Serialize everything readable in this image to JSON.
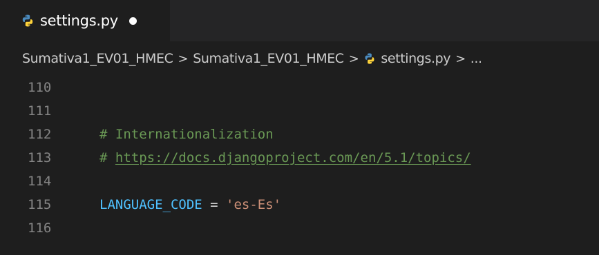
{
  "tab": {
    "label": "settings.py",
    "icon": "python-icon",
    "modified": true
  },
  "breadcrumb": {
    "items": [
      "Sumativa1_EV01_HMEC",
      "Sumativa1_EV01_HMEC",
      "settings.py",
      "..."
    ],
    "separator": ">"
  },
  "editor": {
    "lines": [
      {
        "number": "110",
        "text": ""
      },
      {
        "number": "111",
        "text": ""
      },
      {
        "number": "112",
        "hash": "# ",
        "text": "Internationalization"
      },
      {
        "number": "113",
        "hash": "# ",
        "text": "https://docs.djangoproject.com/en/5.1/topics/"
      },
      {
        "number": "114",
        "text": ""
      },
      {
        "number": "115",
        "name": "LANGUAGE_CODE",
        "op": " = ",
        "value": "'es-Es'"
      },
      {
        "number": "116",
        "text": ""
      }
    ]
  },
  "colors": {
    "background": "#1e1e1e",
    "comment": "#6a9955",
    "constant": "#4fc1ff",
    "string": "#ce9178",
    "line_number": "#858585"
  }
}
